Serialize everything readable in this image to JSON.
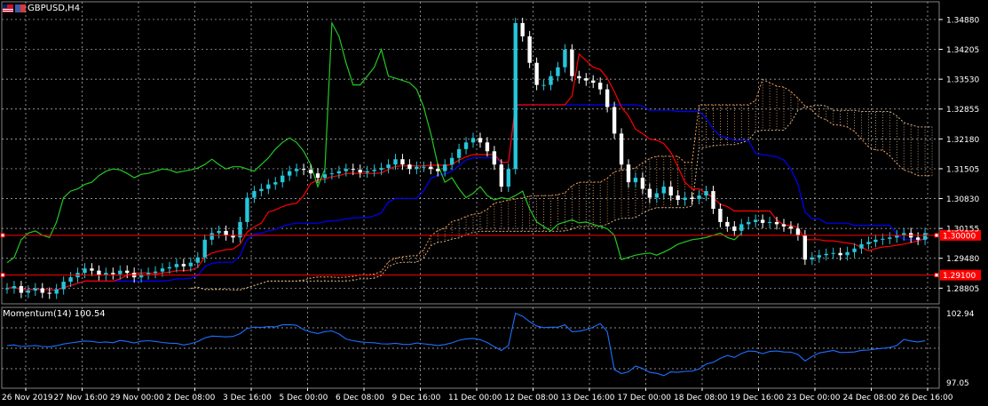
{
  "header": {
    "symbol": "GBPUSD,H4"
  },
  "indicator": {
    "label": "Momentum(14) 100.54"
  },
  "colors": {
    "background": "#000000",
    "grid": "#c0c0c0",
    "bull_candle": "#26c6da",
    "bear_candle": "#ffffff",
    "tenkan": "#ff0000",
    "kijun": "#0000ff",
    "chikou": "#22c922",
    "senkou_a": "#f4a460",
    "senkou_b": "#d2b48c",
    "level_line": "#ff0000",
    "momentum": "#1e6fff"
  },
  "chart_data": [
    {
      "type": "candlestick",
      "title": "GBPUSD,H4",
      "y_ticks": [
        "1.34880",
        "1.34205",
        "1.33530",
        "1.32855",
        "1.32180",
        "1.31505",
        "1.30830",
        "1.30155",
        "1.29480",
        "1.28805"
      ],
      "x_ticks": [
        "26 Nov 2019",
        "27 Nov 16:00",
        "29 Nov 00:00",
        "2 Dec 08:00",
        "3 Dec 16:00",
        "5 Dec 00:00",
        "6 Dec 08:00",
        "9 Dec 16:00",
        "11 Dec 00:00",
        "12 Dec 08:00",
        "13 Dec 16:00",
        "17 Dec 00:00",
        "18 Dec 08:00",
        "19 Dec 16:00",
        "23 Dec 00:00",
        "24 Dec 08:00",
        "26 Dec 16:00"
      ],
      "ylim": [
        1.2845,
        1.3512
      ],
      "levels": [
        {
          "price": 1.3,
          "label": "1.30000"
        },
        {
          "price": 1.291,
          "label": "1.29100"
        }
      ],
      "close": [
        1.288,
        1.2885,
        1.287,
        1.2875,
        1.288,
        1.287,
        1.2868,
        1.2878,
        1.2895,
        1.2905,
        1.2915,
        1.2925,
        1.292,
        1.291,
        1.2915,
        1.2912,
        1.292,
        1.2915,
        1.2905,
        1.2912,
        1.2915,
        1.2918,
        1.2925,
        1.2928,
        1.2935,
        1.293,
        1.2938,
        1.295,
        1.299,
        1.3005,
        1.301,
        1.3,
        1.2995,
        1.303,
        1.3085,
        1.31,
        1.3105,
        1.3115,
        1.312,
        1.3135,
        1.3145,
        1.315,
        1.3148,
        1.314,
        1.313,
        1.3138,
        1.314,
        1.3145,
        1.315,
        1.3148,
        1.3142,
        1.3145,
        1.3148,
        1.3152,
        1.316,
        1.3172,
        1.316,
        1.315,
        1.3155,
        1.3155,
        1.315,
        1.3145,
        1.316,
        1.3175,
        1.3195,
        1.321,
        1.322,
        1.321,
        1.319,
        1.316,
        1.311,
        1.315,
        1.348,
        1.345,
        1.339,
        1.334,
        1.334,
        1.336,
        1.338,
        1.342,
        1.336,
        1.3355,
        1.335,
        1.3345,
        1.333,
        1.329,
        1.323,
        1.316,
        1.312,
        1.313,
        1.3105,
        1.3085,
        1.3095,
        1.311,
        1.309,
        1.308,
        1.3085,
        1.3082,
        1.309,
        1.31,
        1.306,
        1.303,
        1.302,
        1.301,
        1.3025,
        1.303,
        1.3035,
        1.3028,
        1.303,
        1.3025,
        1.302,
        1.3015,
        1.3,
        1.2945,
        1.295,
        1.2955,
        1.2958,
        1.296,
        1.2955,
        1.2962,
        1.297,
        1.298,
        1.2985,
        1.299,
        1.2992,
        1.2995,
        1.3,
        1.3005,
        1.2995,
        1.299,
        1.3005
      ],
      "momentum": {
        "label": "Momentum(14) 100.54",
        "last": 100.54,
        "y_ticks": [
          "102.94",
          "97.05"
        ],
        "ylim": [
          96.9,
          103.1
        ]
      }
    }
  ]
}
